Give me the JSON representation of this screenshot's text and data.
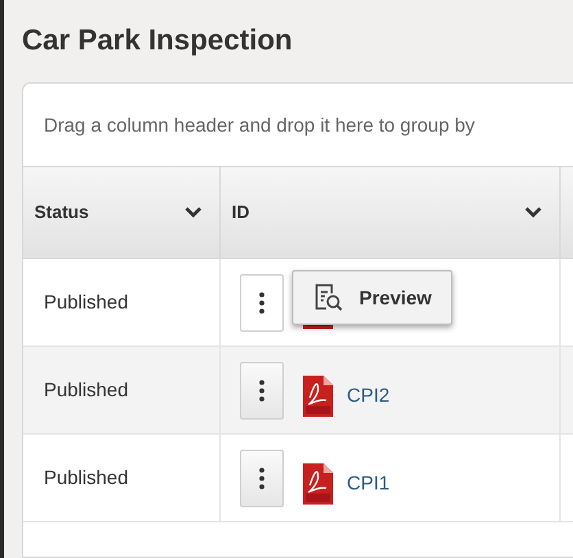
{
  "page_title": "Car Park Inspection",
  "group_hint": "Drag a column header and drop it here to group by",
  "columns": [
    {
      "label": "Status"
    },
    {
      "label": "ID"
    }
  ],
  "rows": [
    {
      "status": "Published",
      "id": null,
      "menu_open": true,
      "menu_items": [
        {
          "label": "Preview"
        }
      ]
    },
    {
      "status": "Published",
      "id": "CPI2",
      "menu_open": false
    },
    {
      "status": "Published",
      "id": "CPI1",
      "menu_open": false
    }
  ]
}
